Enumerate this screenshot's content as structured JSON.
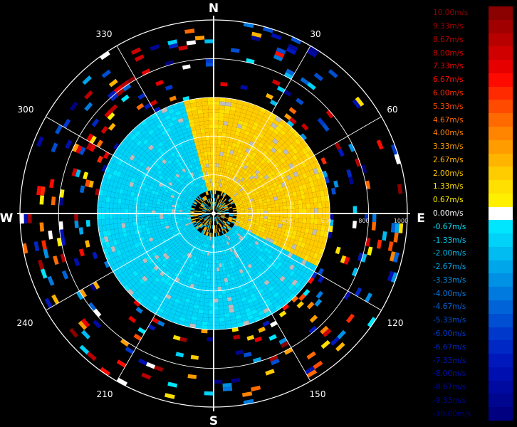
{
  "chart_data": {
    "type": "heatmap",
    "subtype": "polar-radar-velocity",
    "cardinals": [
      "N",
      "E",
      "S",
      "W"
    ],
    "azimuth_labels": [
      "30",
      "60",
      "120",
      "150",
      "210",
      "240",
      "300",
      "330"
    ],
    "range_labels": [
      "400",
      "600",
      "800",
      "1000"
    ],
    "rings": [
      200,
      400,
      600,
      800,
      1000
    ],
    "max_range": 1000,
    "colorbar": [
      {
        "label": "10.00m/s",
        "value": 10.0,
        "color": "#8b0000"
      },
      {
        "label": "9.33m/s",
        "value": 9.33,
        "color": "#a00000"
      },
      {
        "label": "8.67m/s",
        "value": 8.67,
        "color": "#b80000"
      },
      {
        "label": "8.00m/s",
        "value": 8.0,
        "color": "#d00000"
      },
      {
        "label": "7.33m/s",
        "value": 7.33,
        "color": "#e60000"
      },
      {
        "label": "6.67m/s",
        "value": 6.67,
        "color": "#ff0a00"
      },
      {
        "label": "6.00m/s",
        "value": 6.0,
        "color": "#ff2a00"
      },
      {
        "label": "5.33m/s",
        "value": 5.33,
        "color": "#ff4a00"
      },
      {
        "label": "4.67m/s",
        "value": 4.67,
        "color": "#ff6a00"
      },
      {
        "label": "4.00m/s",
        "value": 4.0,
        "color": "#ff8400"
      },
      {
        "label": "3.33m/s",
        "value": 3.33,
        "color": "#ff9c00"
      },
      {
        "label": "2.67m/s",
        "value": 2.67,
        "color": "#ffb400"
      },
      {
        "label": "2.00m/s",
        "value": 2.0,
        "color": "#ffcc00"
      },
      {
        "label": "1.33m/s",
        "value": 1.33,
        "color": "#ffe000"
      },
      {
        "label": "0.67m/s",
        "value": 0.67,
        "color": "#fff000"
      },
      {
        "label": "0.00m/s",
        "value": 0.0,
        "color": "#ffffff"
      },
      {
        "label": "-0.67m/s",
        "value": -0.67,
        "color": "#00e6ff"
      },
      {
        "label": "-1.33m/s",
        "value": -1.33,
        "color": "#00d2f8"
      },
      {
        "label": "-2.00m/s",
        "value": -2.0,
        "color": "#00bcf0"
      },
      {
        "label": "-2.67m/s",
        "value": -2.67,
        "color": "#00a6ea"
      },
      {
        "label": "-3.33m/s",
        "value": -3.33,
        "color": "#0090e4"
      },
      {
        "label": "-4.00m/s",
        "value": -4.0,
        "color": "#007ade"
      },
      {
        "label": "-4.67m/s",
        "value": -4.67,
        "color": "#0064d8"
      },
      {
        "label": "-5.33m/s",
        "value": -5.33,
        "color": "#004ed2"
      },
      {
        "label": "-6.00m/s",
        "value": -6.0,
        "color": "#0038cc"
      },
      {
        "label": "-6.67m/s",
        "value": -6.67,
        "color": "#0028c4"
      },
      {
        "label": "-7.33m/s",
        "value": -7.33,
        "color": "#0018bc"
      },
      {
        "label": "-8.00m/s",
        "value": -8.0,
        "color": "#0010b0"
      },
      {
        "label": "-8.67m/s",
        "value": -8.67,
        "color": "#000aa0"
      },
      {
        "label": "-9.33m/s",
        "value": -9.33,
        "color": "#000690"
      },
      {
        "label": "-10.00m/s",
        "value": -10.0,
        "color": "#000080"
      }
    ],
    "velocity_regions": [
      {
        "az_from": 345,
        "az_to": 115,
        "r_from": 120,
        "r_to": 600,
        "value": 1.8
      },
      {
        "az_from": 195,
        "az_to": 300,
        "r_from": 120,
        "r_to": 600,
        "value": -1.2
      },
      {
        "az_from": 300,
        "az_to": 345,
        "r_from": 120,
        "r_to": 600,
        "value": -1.2
      },
      {
        "az_from": 115,
        "az_to": 195,
        "r_from": 120,
        "r_to": 600,
        "value": -1.2
      },
      {
        "az_from": 0,
        "az_to": 360,
        "r_from": 600,
        "r_to": 1000,
        "value": 4.0,
        "sparse": true
      }
    ]
  }
}
